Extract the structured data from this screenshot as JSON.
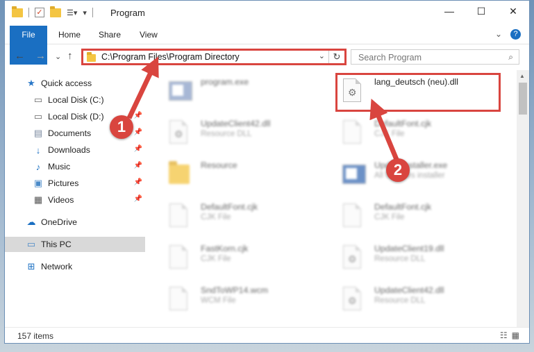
{
  "window": {
    "title": "Program",
    "controls": {
      "minimize": "—",
      "maximize": "☐",
      "close": "✕"
    }
  },
  "ribbon": {
    "tabs": [
      "File",
      "Home",
      "Share",
      "View"
    ],
    "collapse_glyph": "⌄",
    "help_glyph": "?"
  },
  "address": {
    "path": "C:\\Program Files\\Program Directory",
    "dropdown_glyph": "⌄",
    "refresh_glyph": "↻"
  },
  "search": {
    "placeholder": "Search Program",
    "icon": "search-icon"
  },
  "nav_buttons": {
    "back": "←",
    "forward": "→",
    "recent": "⌄",
    "up": "↑"
  },
  "nav_pane": {
    "items": [
      {
        "label": "Quick access",
        "icon": "star-icon",
        "pinned": false
      },
      {
        "label": "Local Disk (C:)",
        "icon": "drive-icon",
        "pinned": false
      },
      {
        "label": "Local Disk (D:)",
        "icon": "drive-icon",
        "pinned": true
      },
      {
        "label": "Documents",
        "icon": "documents-icon",
        "pinned": true
      },
      {
        "label": "Downloads",
        "icon": "download-icon",
        "pinned": true
      },
      {
        "label": "Music",
        "icon": "music-icon",
        "pinned": true
      },
      {
        "label": "Pictures",
        "icon": "pictures-icon",
        "pinned": true
      },
      {
        "label": "Videos",
        "icon": "videos-icon",
        "pinned": true
      },
      {
        "label": "OneDrive",
        "icon": "cloud-icon",
        "pinned": false
      },
      {
        "label": "This PC",
        "icon": "computer-icon",
        "pinned": false,
        "selected": true
      },
      {
        "label": "Network",
        "icon": "network-icon",
        "pinned": false
      }
    ]
  },
  "files": [
    {
      "name": "program.exe",
      "type": "",
      "icon": "exe-icon"
    },
    {
      "name": "lang_deutsch (neu).dll",
      "type": "",
      "icon": "dll-icon",
      "highlighted": true
    },
    {
      "name": "UpdateClient42.dll",
      "type": "Resource DLL",
      "icon": "dll-icon"
    },
    {
      "name": "DefaultFont.cjk",
      "type": "CJK File",
      "icon": "file-icon"
    },
    {
      "name": "Resource",
      "type": "",
      "icon": "folder-icon"
    },
    {
      "name": "UpdateInstaller.exe",
      "type": "All Updates installer",
      "icon": "installer-icon"
    },
    {
      "name": "DefaultFont.cjk",
      "type": "CJK File",
      "icon": "file-icon"
    },
    {
      "name": "DefaultFont.cjk",
      "type": "CJK File",
      "icon": "file-icon"
    },
    {
      "name": "FastKorn.cjk",
      "type": "CJK File",
      "icon": "file-icon"
    },
    {
      "name": "UpdateClient19.dll",
      "type": "Resource DLL",
      "icon": "dll-icon"
    },
    {
      "name": "SndToWP14.wcm",
      "type": "WCM File",
      "icon": "file-icon"
    },
    {
      "name": "UpdateClient42.dll",
      "type": "Resource DLL",
      "icon": "dll-icon"
    }
  ],
  "status": {
    "item_count": "157 items"
  },
  "annotations": {
    "step1": "1",
    "step2": "2",
    "color": "#d9453f"
  }
}
